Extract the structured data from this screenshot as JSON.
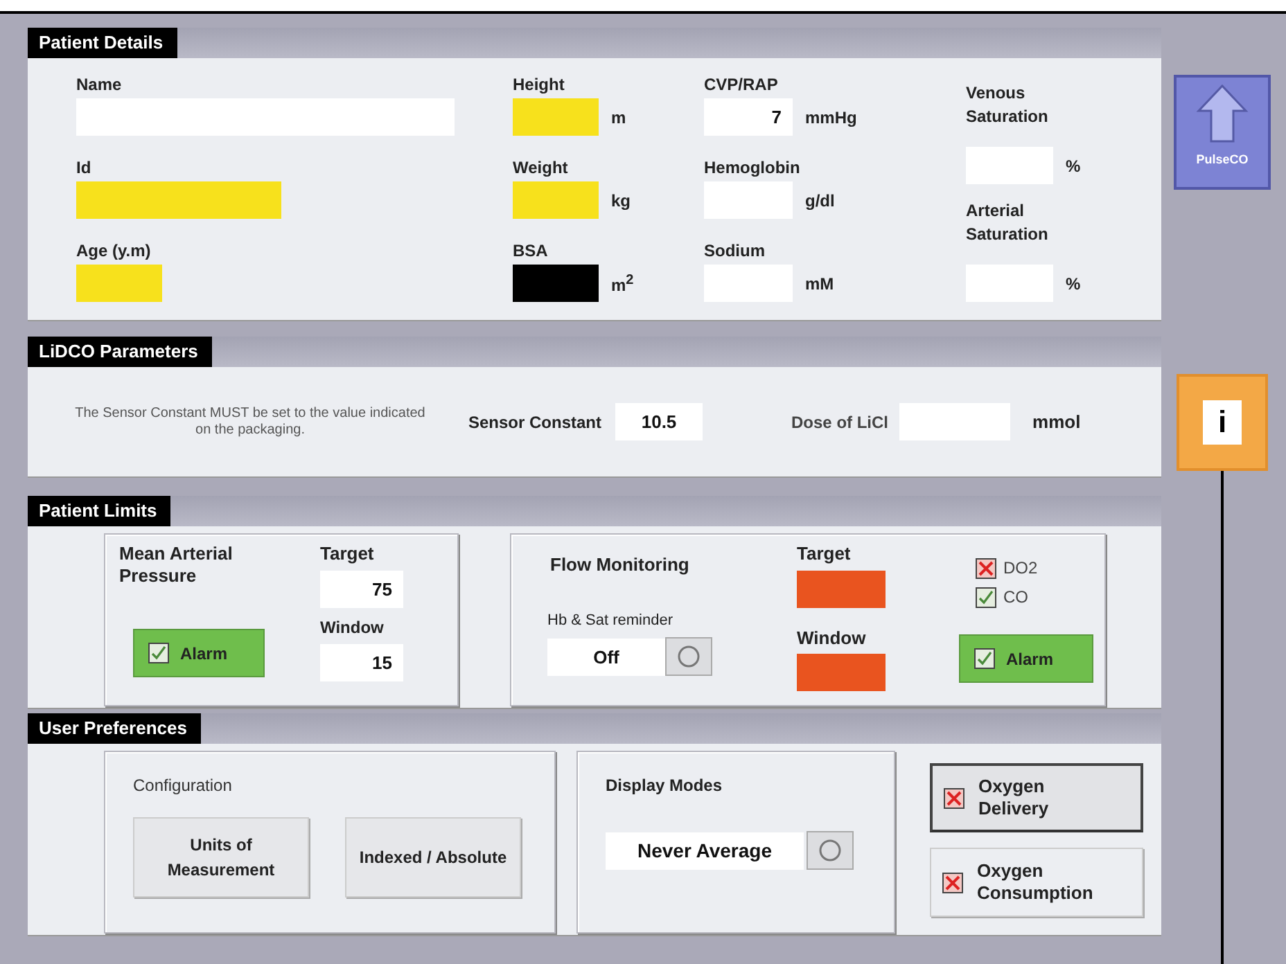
{
  "patient_details": {
    "title": "Patient Details",
    "columns": [
      [
        {
          "label": "Name",
          "color": "#ffffff"
        },
        {
          "label": "Id",
          "color": "#f7e11c"
        },
        {
          "label": "Age (y.m)",
          "color": "#f7e11c"
        }
      ],
      [
        {
          "label": "Height",
          "color": "#f7e11c",
          "unit": "m"
        },
        {
          "label": "Weight",
          "color": "#f7e11c",
          "unit": "kg"
        },
        {
          "label": "BSA",
          "color": "#000000",
          "unit": "m$^{2}$"
        }
      ],
      [
        {
          "label": "CVP/RAP",
          "value": "7",
          "color": "#ffffff",
          "unit": "mmHg"
        },
        {
          "label": "Hemoglobin",
          "color": "#ffffff",
          "unit": "g/dl"
        },
        {
          "label": "Sodium",
          "color": "#ffffff",
          "unit": "mM"
        }
      ],
      [
        {
          "label": "Venous Saturation",
          "color": "#ffffff",
          "unit": "%"
        },
        {
          "label": "Arterial Saturation",
          "color": "#ffffff",
          "unit": "%"
        }
      ]
    ]
  },
  "lidco": {
    "title": "LiDCO Parameters",
    "note": "The Sensor Constant MUST be set to the value indicated on the packaging.",
    "sensor_constant": {
      "label": "Sensor Constant",
      "value": "10.5"
    },
    "licl_dose": {
      "label": "Dose of LiCl",
      "unit": "mmol"
    }
  },
  "patient_limits": {
    "title": "Patient Limits",
    "map": {
      "label": "Mean Arterial Pressure",
      "target": {
        "label": "Target",
        "value": "75"
      },
      "window": {
        "label": "Window",
        "value": "15"
      },
      "alarm": {
        "label": "Alarm",
        "checked": true
      }
    },
    "flow": {
      "label": "Flow Monitoring",
      "reminder": {
        "label": "Hb & Sat reminder",
        "value": "Off"
      },
      "target": {
        "label": "Target",
        "color": "#e9541f"
      },
      "window": {
        "label": "Window",
        "color": "#e9541f"
      },
      "checks": [
        {
          "label": "DO2",
          "checked": true,
          "kind": "cross"
        },
        {
          "label": "CO",
          "checked": true,
          "kind": "tick"
        }
      ],
      "alarm": {
        "label": "Alarm",
        "checked": true
      }
    }
  },
  "user_preferences": {
    "title": "User Preferences",
    "configuration": {
      "label": "Configuration",
      "buttons": [
        "Units of Measurement",
        "Indexed / Absolute"
      ]
    },
    "display_modes": {
      "label": "Display Modes",
      "value": "Never Average"
    },
    "toggles": [
      {
        "label": "Oxygen Delivery",
        "checked": true,
        "selected": true
      },
      {
        "label": "Oxygen Consumption",
        "checked": true,
        "selected": false
      }
    ]
  },
  "side_buttons": {
    "pulseco": "PulseCO",
    "info": "i"
  }
}
